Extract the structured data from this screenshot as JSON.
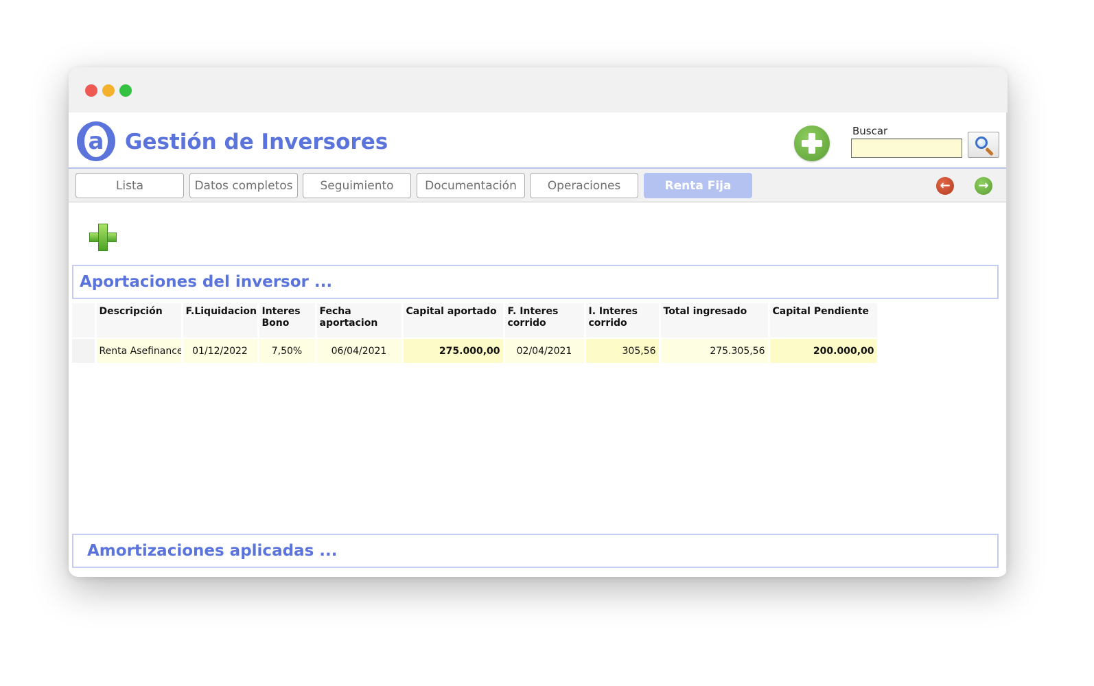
{
  "app": {
    "title": "Gestión de Inversores",
    "logo_letter": "a",
    "brand_color": "#5b74dc"
  },
  "search": {
    "label": "Buscar",
    "value": "",
    "placeholder": ""
  },
  "icons": {
    "add_big": "plus-circle-icon",
    "add_small": "plus-icon",
    "search": "magnifier-icon",
    "back": "arrow-left-icon",
    "forward": "arrow-right-icon"
  },
  "tabs": [
    {
      "label": "Lista",
      "active": false
    },
    {
      "label": "Datos completos",
      "active": false
    },
    {
      "label": "Seguimiento",
      "active": false
    },
    {
      "label": "Documentación",
      "active": false
    },
    {
      "label": "Operaciones",
      "active": false
    },
    {
      "label": "Renta Fija",
      "active": true
    }
  ],
  "sections": {
    "aportaciones": {
      "title": "Aportaciones del inversor ...",
      "columns": [
        "Descripción",
        "F.Liquidacion",
        "Interes Bono",
        "Fecha aportacion",
        "Capital aportado",
        "F. Interes corrido",
        "I. Interes corrido",
        "Total ingresado",
        "Capital Pendiente"
      ],
      "rows": [
        [
          "Renta Asefinance",
          "01/12/2022",
          "7,50%",
          "06/04/2021",
          "275.000,00",
          "02/04/2021",
          "305,56",
          "275.305,56",
          "200.000,00"
        ]
      ]
    },
    "amortizaciones": {
      "title": "Amortizaciones aplicadas ..."
    }
  }
}
